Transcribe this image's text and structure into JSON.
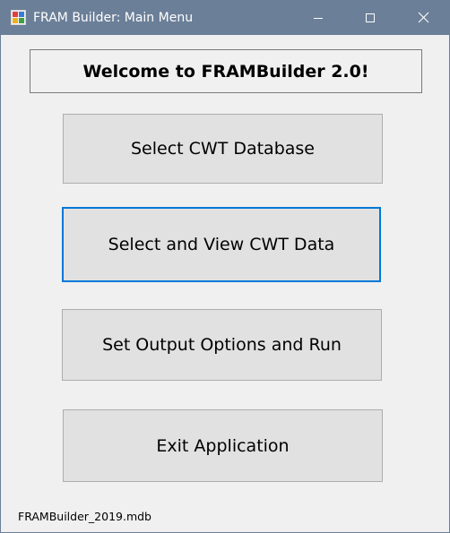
{
  "window": {
    "title": "FRAM Builder: Main Menu",
    "icon": "app-icon"
  },
  "title_bar": {
    "minimize_icon": "minimize-icon",
    "maximize_icon": "maximize-icon",
    "close_icon": "close-icon"
  },
  "welcome": {
    "text": "Welcome to FRAMBuilder 2.0!"
  },
  "buttons": {
    "select_db": "Select CWT Database",
    "select_view": "Select and View CWT Data",
    "set_output": "Set Output Options and Run",
    "exit": "Exit Application"
  },
  "status": {
    "database_file": "FRAMBuilder_2019.mdb"
  },
  "colors": {
    "title_bar": "#6b7f98",
    "window_bg": "#f0f0f0",
    "button_bg": "#e1e1e1",
    "focus_border": "#0078d7"
  }
}
